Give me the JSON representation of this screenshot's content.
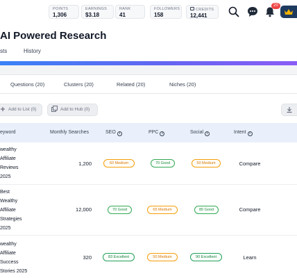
{
  "stats": [
    {
      "label": "POINTS",
      "value": "1,306"
    },
    {
      "label": "EARNINGS",
      "value": "$3.18"
    },
    {
      "label": "RANK",
      "value": "41"
    },
    {
      "label": "FOLLOWERS",
      "value": "158"
    },
    {
      "label": "CREDITS",
      "value": "12,441"
    }
  ],
  "notifications": {
    "count": "20"
  },
  "page": {
    "title": "AI Powered Research"
  },
  "view_tabs": [
    "sts",
    "History"
  ],
  "sub_tabs": [
    "Questions (20)",
    "Clusters (20)",
    "Related (20)",
    "Niches (20)"
  ],
  "actions": {
    "add_list": "Add to List (0)",
    "add_hub": "Add to Hub (0)"
  },
  "table": {
    "headers": {
      "keyword": "eyword",
      "monthly": "Monthly Searches",
      "seo": "SEO",
      "ppc": "PPC",
      "social": "Social",
      "intent": "Intent"
    },
    "rows": [
      {
        "keyword": "wealthy\nAffiliate\nReviews\n2025",
        "monthly": "1,200",
        "seo": "60 Medium",
        "seo_level": "medium",
        "ppc": "70 Good",
        "ppc_level": "good",
        "social": "50 Medium",
        "social_level": "medium",
        "intent": "Compare"
      },
      {
        "keyword": "Best\nWealthy\nAffiliate\nStrategies\n2025",
        "monthly": "12,000",
        "seo": "70 Good",
        "seo_level": "good",
        "ppc": "65 Medium",
        "ppc_level": "medium",
        "social": "80 Good",
        "social_level": "good",
        "intent": "Compare"
      },
      {
        "keyword": "wealthy\nAffiliate\nSuccess\nStories 2025",
        "monthly": "320",
        "seo": "83 Excellent",
        "seo_level": "excellent",
        "ppc": "50 Medium",
        "ppc_level": "medium",
        "social": "90 Excellent",
        "social_level": "excellent",
        "intent": "Learn"
      }
    ]
  },
  "colors": {
    "accent_gradient_start": "#3b82f6",
    "accent_gradient_end": "#8b5cf6",
    "header_bg": "#e9f0fb"
  }
}
